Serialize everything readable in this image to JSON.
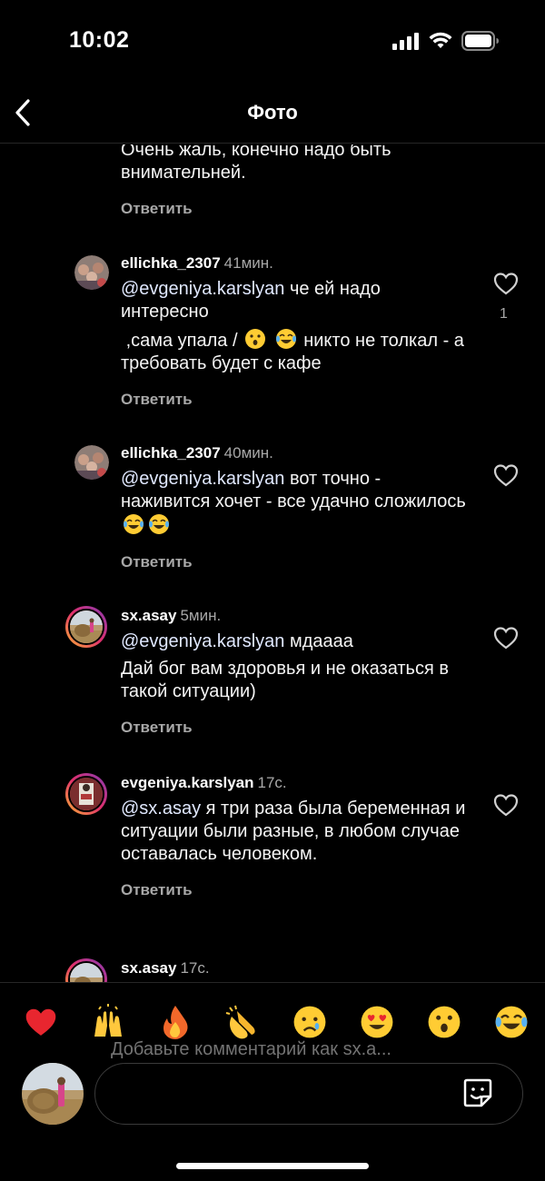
{
  "status_bar": {
    "time": "10:02"
  },
  "nav": {
    "title": "Фото"
  },
  "comments": [
    {
      "text_line1": "Очень жаль, конечно надо быть",
      "text_line2": "внимательней.",
      "reply": "Ответить"
    },
    {
      "username": "ellichka_2307",
      "time": "41мин.",
      "mention": "@evgeniya.karslyan",
      "text_a": " че ей надо интересно",
      "text_b": ",сама упала /",
      "text_c": "никто не толкал - а требовать будет с кафе",
      "likes": "1",
      "reply": "Ответить"
    },
    {
      "username": "ellichka_2307",
      "time": "40мин.",
      "mention": "@evgeniya.karslyan",
      "text_a": " вот точно - наживится хочет - все удачно сложилось",
      "reply": "Ответить"
    },
    {
      "username": "sx.asay",
      "time": "5мин.",
      "mention": "@evgeniya.karslyan",
      "text_a": " мдаааа",
      "text_b": "Дай бог вам здоровья и не оказаться в такой ситуации)",
      "reply": "Ответить"
    },
    {
      "username": "evgeniya.karslyan",
      "time": "17с.",
      "mention": "@sx.asay",
      "text_a": " я три раза была беременная и ситуации были разные, в любом случае оставалась человеком.",
      "reply": "Ответить"
    },
    {
      "username": "sx.asay",
      "time": "17с."
    }
  ],
  "composer": {
    "placeholder": "Добавьте комментарий как sx.a...",
    "reactions": [
      "red-heart",
      "raising-hands",
      "fire",
      "clapping-hands",
      "crying-face",
      "heart-eyes",
      "surprised-face",
      "tears-of-joy"
    ]
  },
  "colors": {
    "background": "#000000",
    "secondary_text": "#a8a8a8",
    "mention": "#d6e4ff",
    "ring_gradient": [
      "#f9b233",
      "#e1306c",
      "#833ab4"
    ]
  }
}
